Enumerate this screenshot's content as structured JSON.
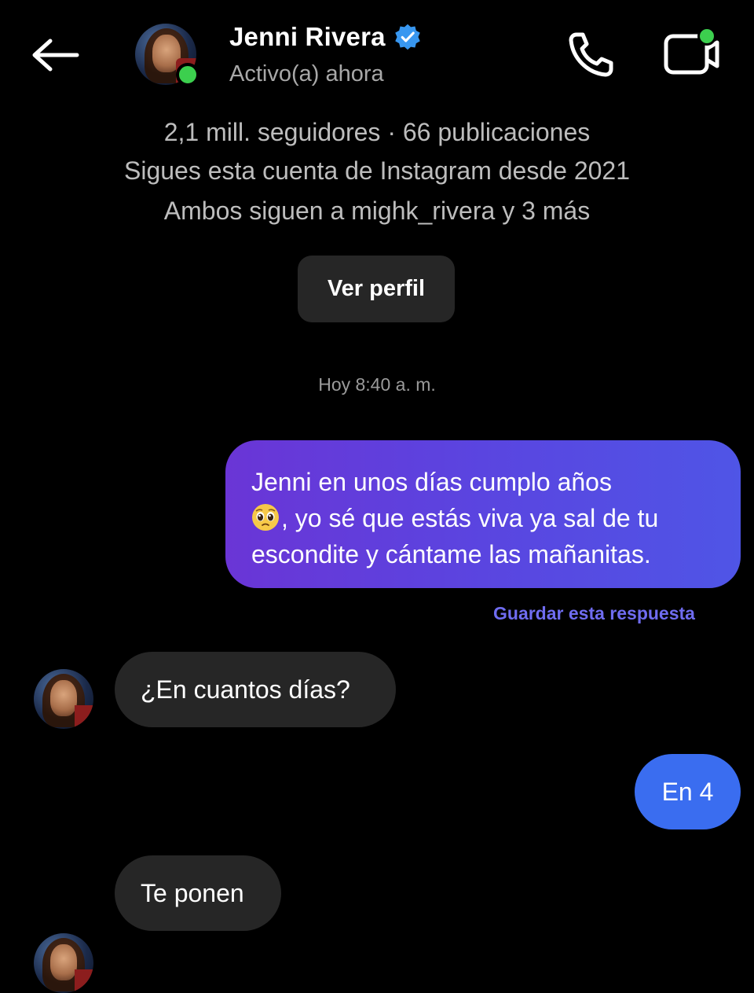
{
  "header": {
    "name": "Jenni Rivera",
    "status": "Activo(a) ahora",
    "back_icon": "back-arrow-icon",
    "call_icon": "phone-icon",
    "video_icon": "video-call-icon"
  },
  "profile_info": {
    "stats": "2,1 mill. seguidores · 66 publicaciones",
    "following_since": "Sigues esta cuenta de Instagram desde 2021",
    "mutual": "Ambos siguen a mighk_rivera y 3 más",
    "view_profile_label": "Ver perfil"
  },
  "thread": {
    "timestamp": "Hoy 8:40 a. m.",
    "messages": [
      {
        "direction": "outgoing",
        "line1": "Jenni en unos días cumplo años",
        "line2_after_emoji": ", yo sé que estás viva ya sal de tu",
        "line3": "escondite y cántame las mañanitas.",
        "emoji": "pleading-face"
      },
      {
        "direction": "incoming",
        "text": "¿En cuantos días?"
      },
      {
        "direction": "outgoing",
        "text": "En 4"
      },
      {
        "direction": "incoming",
        "text": "Te ponen"
      }
    ],
    "save_reply_label": "Guardar esta respuesta"
  },
  "colors": {
    "background": "#000000",
    "online": "#3ccf4e",
    "verified": "#3897f0",
    "outgoing_gradient_start": "#6a35d6",
    "outgoing_gradient_end": "#4f55e6",
    "outgoing_short": "#3a6df0",
    "incoming_bubble": "#262626",
    "save_reply": "#6f6cf0"
  }
}
